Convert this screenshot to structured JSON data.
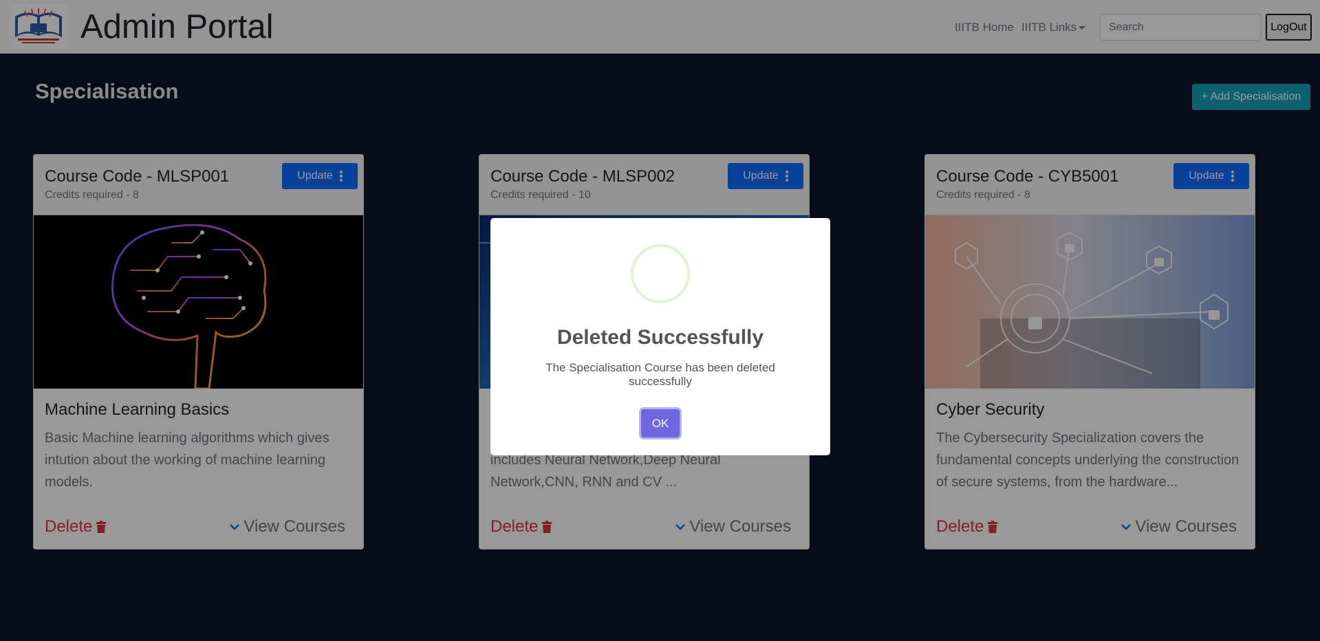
{
  "navbar": {
    "title": "Admin Portal",
    "logo_icon": "iiitb-logo-icon",
    "links": [
      {
        "label": "IIITB Home"
      },
      {
        "label": "IIITB Links"
      }
    ],
    "search_placeholder": "Search",
    "logout_label": "LogOut"
  },
  "page": {
    "title": "Specialisation",
    "add_button_label": "+ Add Specialisation"
  },
  "cards": [
    {
      "course_code": "Course Code - MLSP001",
      "credits": "Credits required - 8",
      "update_label": "Update",
      "image": "neural-brain-image",
      "title": "Machine Learning Basics",
      "description": "Basic Machine learning algorithms which gives intution about the working of machine learning models.",
      "delete_label": "Delete",
      "view_label": "View Courses"
    },
    {
      "course_code": "Course Code - MLSP002",
      "credits": "Credits required - 10",
      "update_label": "Update",
      "image": "deep-learning-image",
      "title": "",
      "description": "includes Neural Network,Deep Neural Network,CNN, RNN and CV ...",
      "delete_label": "Delete",
      "view_label": "View Courses"
    },
    {
      "course_code": "Course Code - CYB5001",
      "credits": "Credits required - 8",
      "update_label": "Update",
      "image": "cyber-security-image",
      "title": "Cyber Security",
      "description": "The Cybersecurity Specialization covers the fundamental concepts underlying the construction of secure systems, from the hardware...",
      "delete_label": "Delete",
      "view_label": "View Courses"
    }
  ],
  "modal": {
    "icon": "success-icon",
    "title": "Deleted Successfully",
    "text": "The Specialisation Course has been deleted successfully",
    "ok_label": "OK",
    "ok_color": "#7066e0"
  },
  "colors": {
    "navbar_bg": "#f8f9fa",
    "page_bg": "#0b1428",
    "primary": "#0d6efd",
    "info": "#17a2b8",
    "danger": "#dc3545"
  }
}
